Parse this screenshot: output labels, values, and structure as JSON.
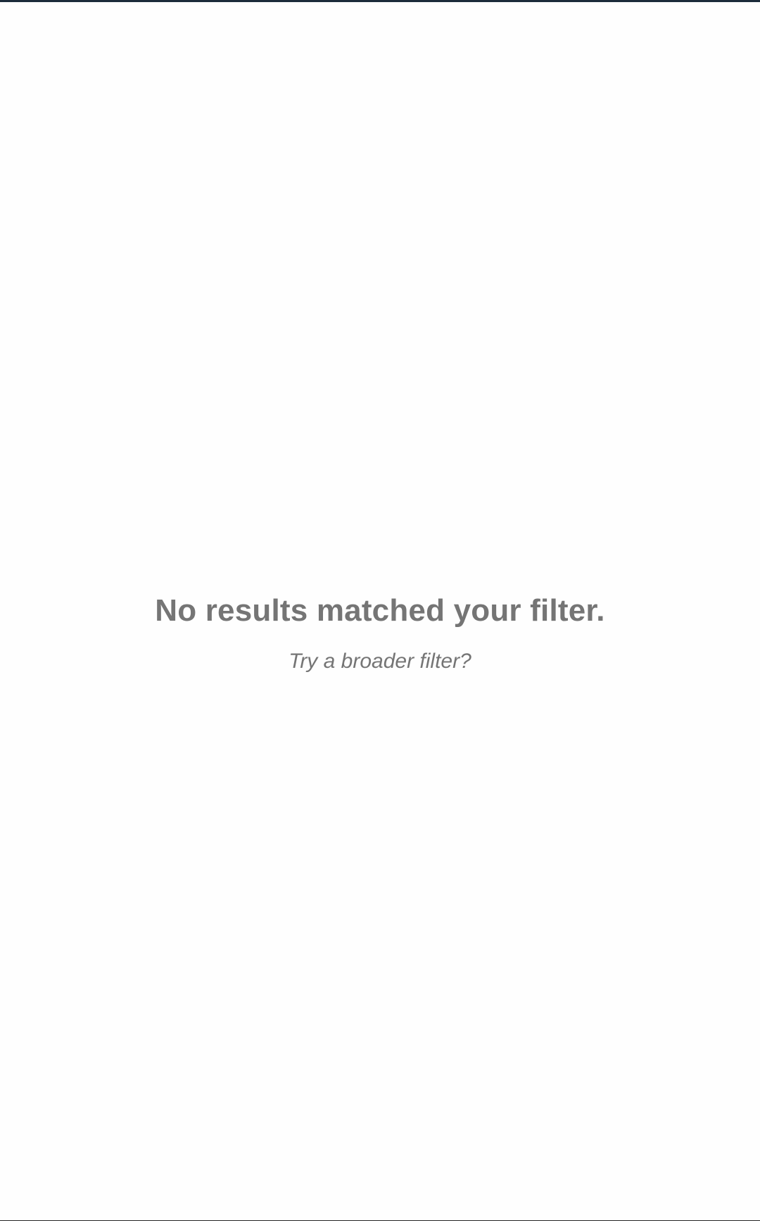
{
  "colors": {
    "top_bar": "#1c2b3a",
    "text_muted": "#757575",
    "background": "#fefefe"
  },
  "empty_state": {
    "title": "No results matched your filter.",
    "subtitle": "Try a broader filter?"
  }
}
